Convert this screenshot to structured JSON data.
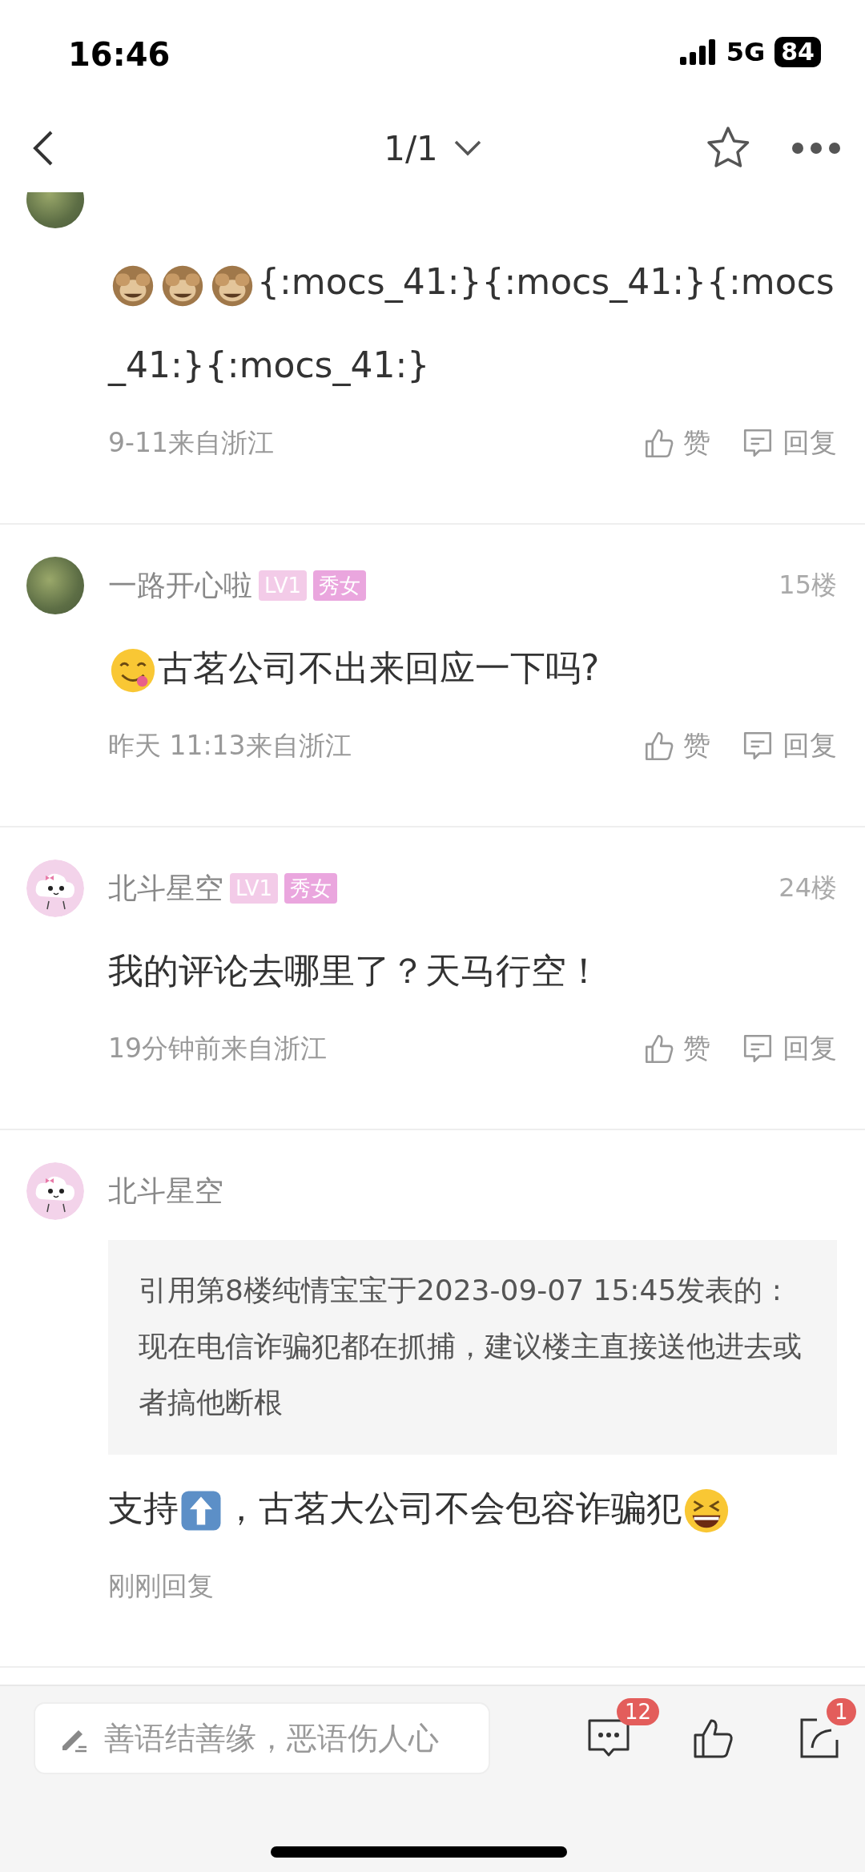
{
  "status_bar": {
    "time": "16:46",
    "network": "5G",
    "battery": "84"
  },
  "nav": {
    "page": "1/1"
  },
  "comments": [
    {
      "avatar": {
        "kind": "photo"
      },
      "segments": [
        {
          "kind": "monkey"
        },
        {
          "kind": "monkey"
        },
        {
          "kind": "monkey"
        },
        {
          "kind": "text",
          "text": "{:mocs_41:}{:mocs_41:}{:mocs"
        },
        {
          "kind": "text",
          "text": "_41:}{:mocs_41:}"
        }
      ],
      "meta": "9-11来自浙江",
      "actions": {
        "like": "赞",
        "reply": "回复"
      }
    },
    {
      "avatar": {
        "kind": "photo"
      },
      "name": "一路开心啦",
      "badges": [
        {
          "text": "LV1",
          "color": "#f3cbe8"
        },
        {
          "text": "秀女",
          "color": "#eaa6de"
        }
      ],
      "floor": "15楼",
      "segments": [
        {
          "kind": "smile"
        },
        {
          "kind": "text",
          "text": "古茗公司不出来回应一下吗?"
        }
      ],
      "meta": "昨天 11:13来自浙江",
      "actions": {
        "like": "赞",
        "reply": "回复"
      }
    },
    {
      "avatar": {
        "kind": "cartoon"
      },
      "name": "北斗星空",
      "badges": [
        {
          "text": "LV1",
          "color": "#f3cbe8"
        },
        {
          "text": "秀女",
          "color": "#eaa6de"
        }
      ],
      "floor": "24楼",
      "segments": [
        {
          "kind": "text",
          "text": "我的评论去哪里了？天马行空！"
        }
      ],
      "meta": "19分钟前来自浙江",
      "actions": {
        "like": "赞",
        "reply": "回复"
      }
    },
    {
      "avatar": {
        "kind": "cartoon"
      },
      "name": "北斗星空",
      "quote": "引用第8楼纯情宝宝于2023-09-07 15:45发表的  :现在电信诈骗犯都在抓捕，建议楼主直接送他进去或者搞他断根",
      "segments": [
        {
          "kind": "text",
          "text": "支持"
        },
        {
          "kind": "up"
        },
        {
          "kind": "text",
          "text": "，古茗大公司不会包容诈骗犯"
        },
        {
          "kind": "grin"
        }
      ],
      "meta": "刚刚回复"
    }
  ],
  "bottom_bar": {
    "input": {
      "placeholder": "善语结善缘，恶语伤人心"
    },
    "comment_count": "12",
    "share_count": "1"
  }
}
